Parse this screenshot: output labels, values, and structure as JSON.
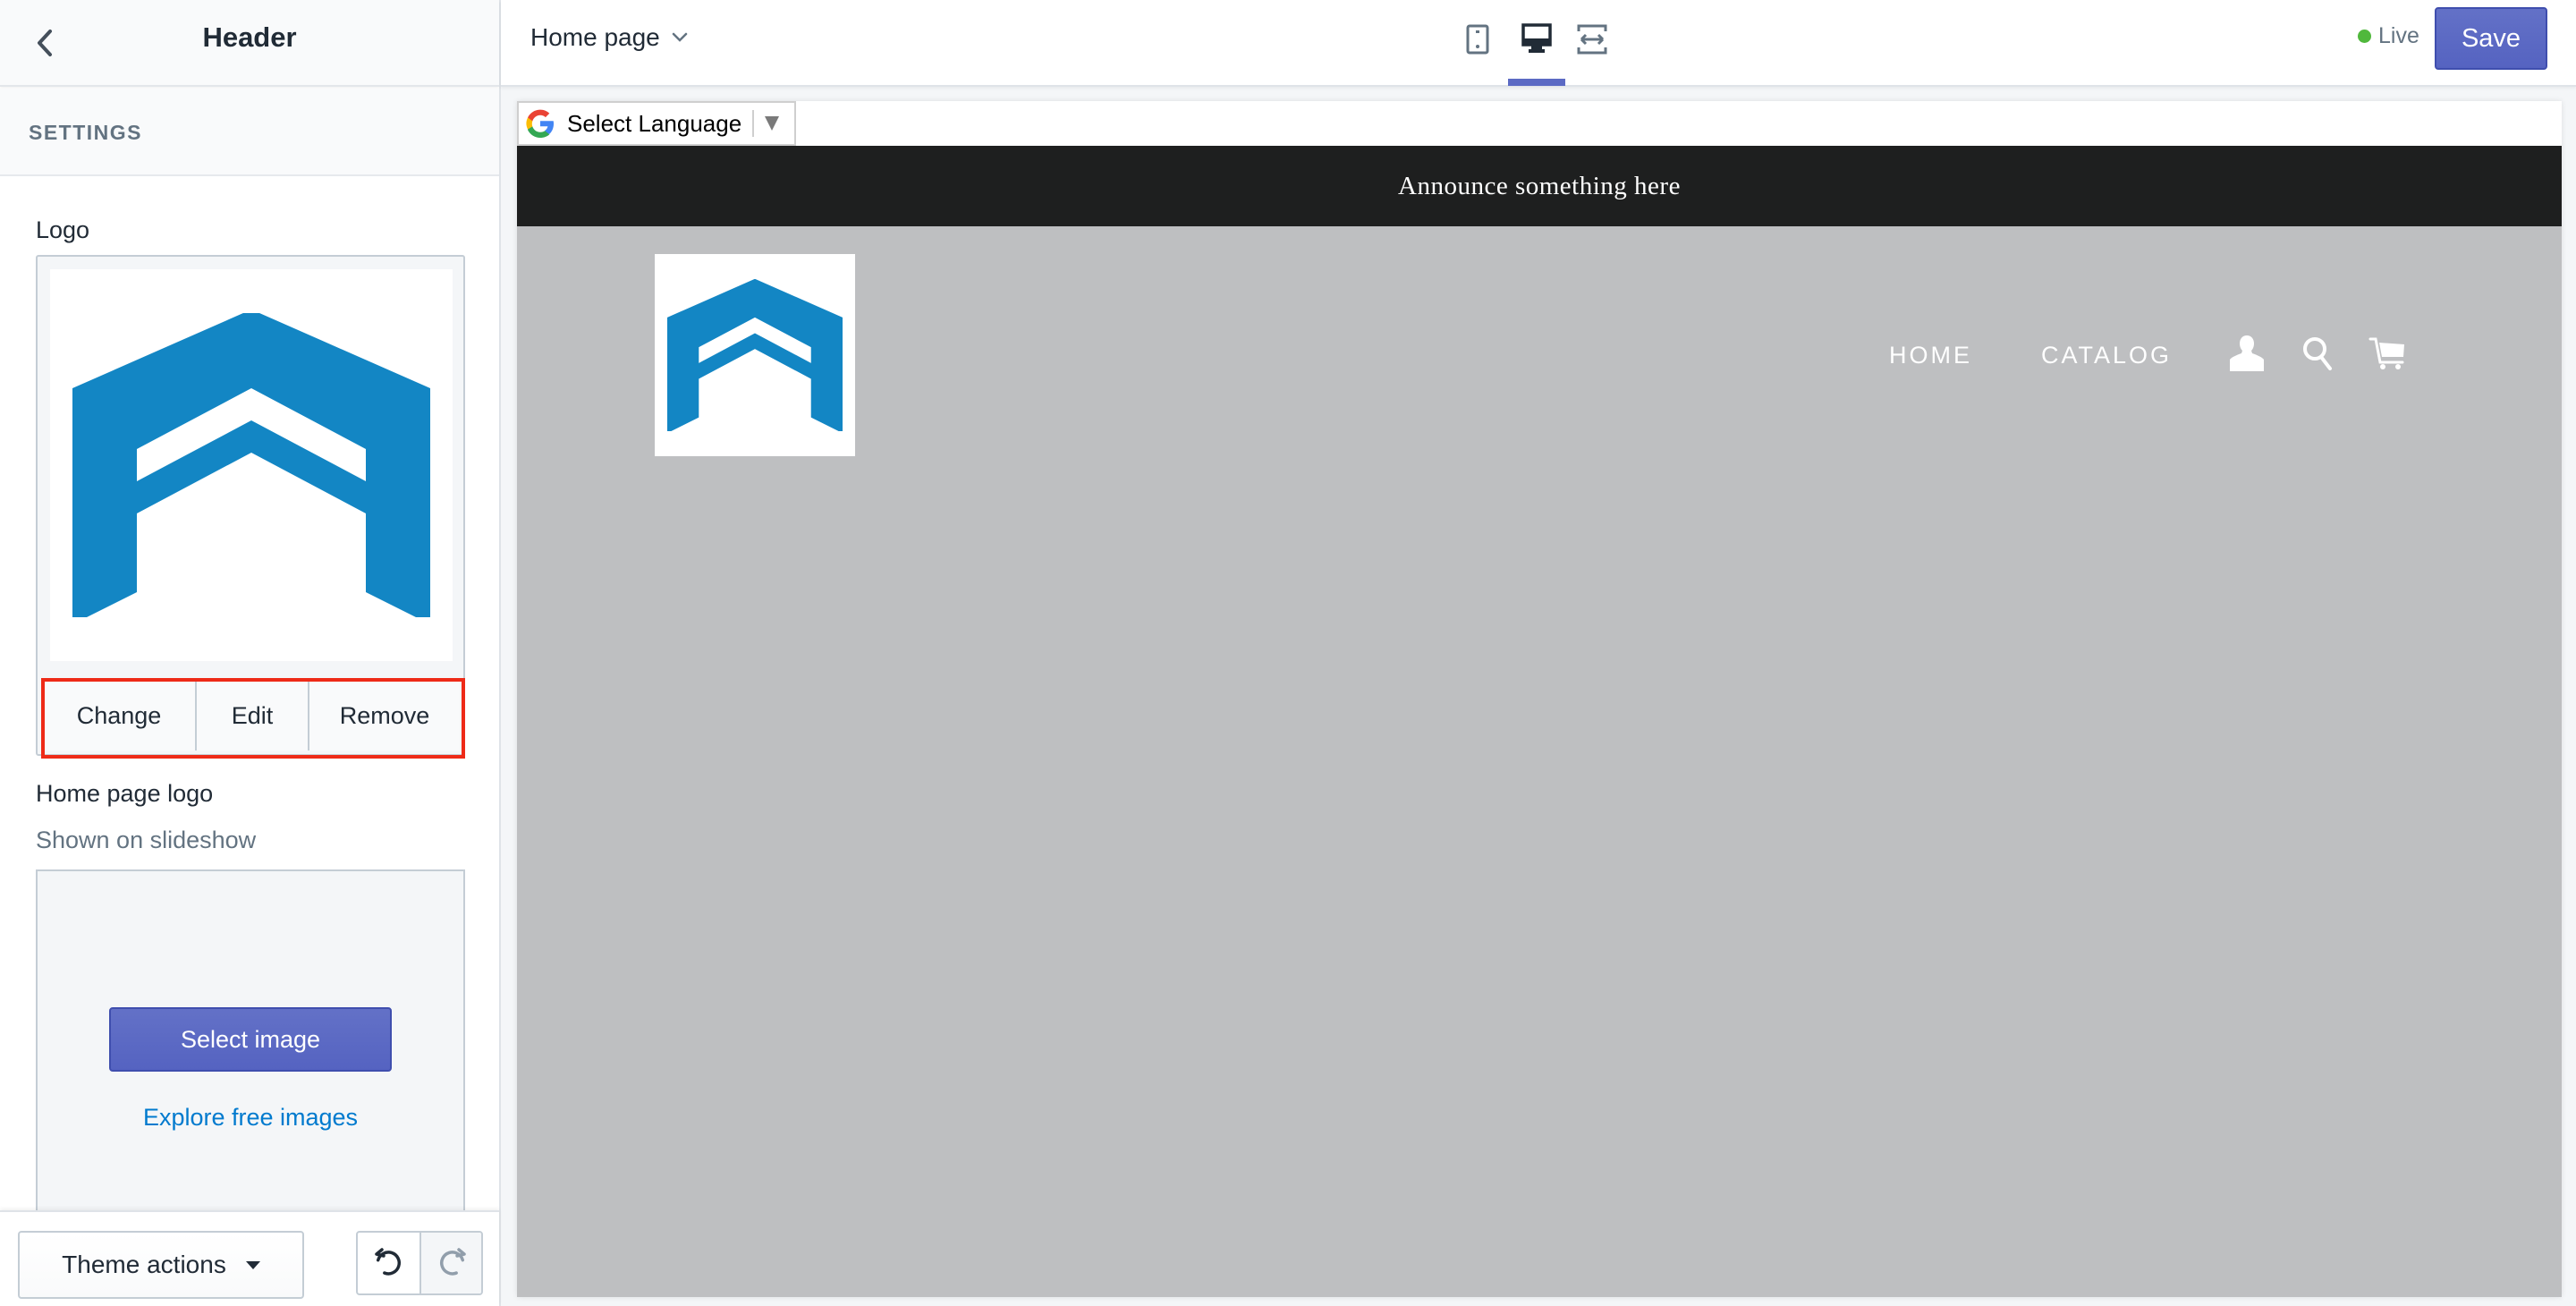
{
  "sidebar": {
    "title": "Header",
    "back_icon": "chevron-left-icon",
    "section_label": "SETTINGS",
    "logo": {
      "label": "Logo",
      "actions": [
        "Change",
        "Edit",
        "Remove"
      ]
    },
    "home_page_logo": {
      "label": "Home page logo",
      "help": "Shown on slideshow",
      "select_button": "Select image",
      "explore_link": "Explore free images"
    },
    "footer": {
      "theme_actions": "Theme actions",
      "undo_icon": "undo-icon",
      "redo_icon": "redo-icon"
    }
  },
  "topbar": {
    "page_selector": "Home page",
    "devices": [
      "mobile",
      "desktop",
      "fullscreen"
    ],
    "active_device": "desktop",
    "status": "Live",
    "status_color": "#50b83c",
    "save": "Save",
    "accent": "#5c6ac4"
  },
  "preview": {
    "translate": {
      "label": "Select Language"
    },
    "announcement": "Announce something here",
    "nav": [
      "HOME",
      "CATALOG"
    ],
    "nav_icons": [
      "account-icon",
      "search-icon",
      "cart-icon"
    ],
    "brand_color": "#1386c4"
  }
}
